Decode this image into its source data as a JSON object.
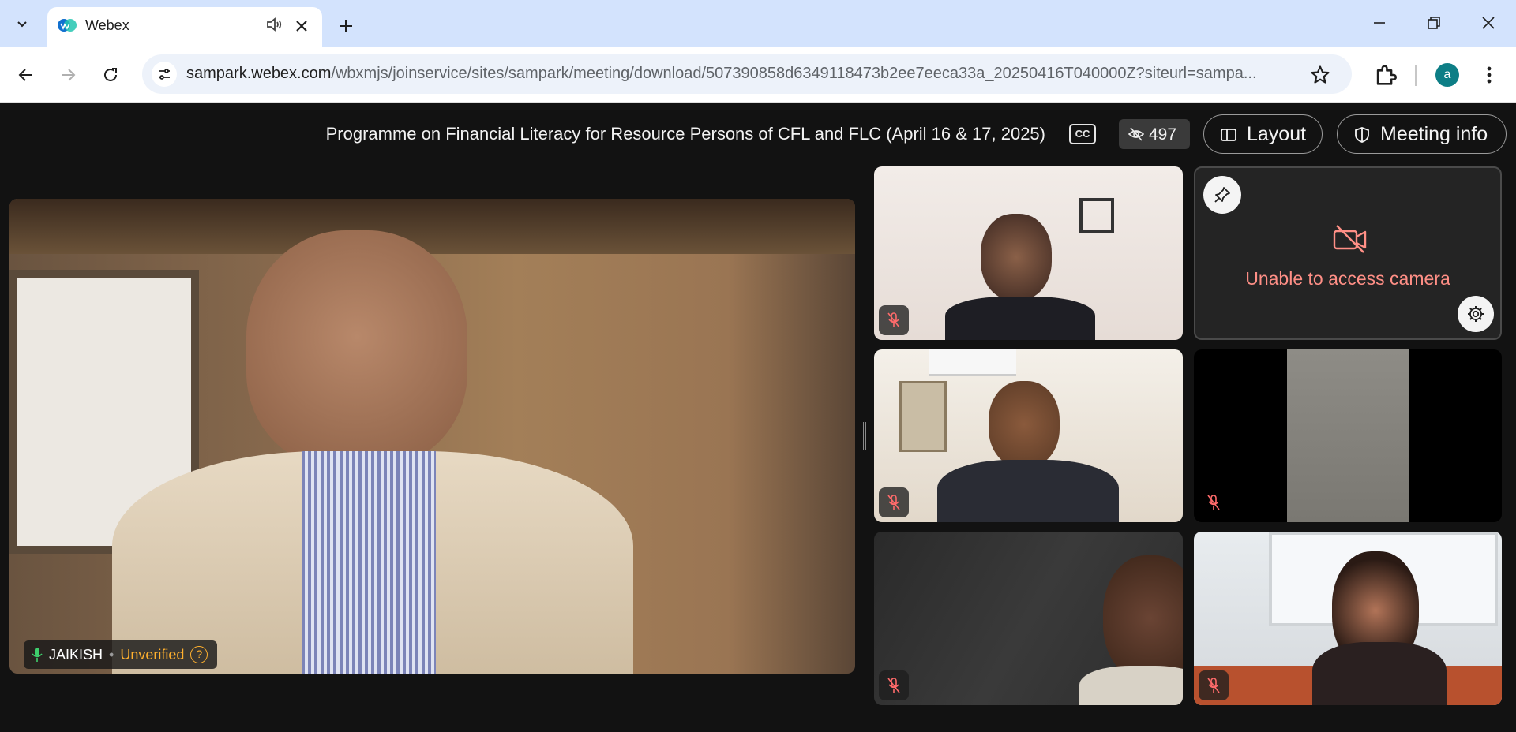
{
  "browser": {
    "tab_title": "Webex",
    "url_host": "sampark.webex.com",
    "url_path": "/wbxmjs/joinservice/sites/sampark/meeting/download/507390858d6349118473b2ee7eeca33a_20250416T040000Z?siteurl=sampa...",
    "profile_initial": "a"
  },
  "meeting": {
    "title": "Programme on Financial Literacy for Resource Persons of CFL and FLC (April 16 & 17, 2025)",
    "cc_label": "CC",
    "viewer_count": "497",
    "layout_label": "Layout",
    "meeting_info_label": "Meeting info"
  },
  "main_speaker": {
    "name": "JAIKISH",
    "separator": "•",
    "status": "Unverified",
    "help_glyph": "?"
  },
  "camera_off_tile": {
    "message": "Unable to access camera"
  },
  "colors": {
    "accent_camera_error": "#ff8f86",
    "unverified": "#ffb02e",
    "mic_active": "#3ecf6c",
    "mic_muted": "#ff6b6b"
  }
}
